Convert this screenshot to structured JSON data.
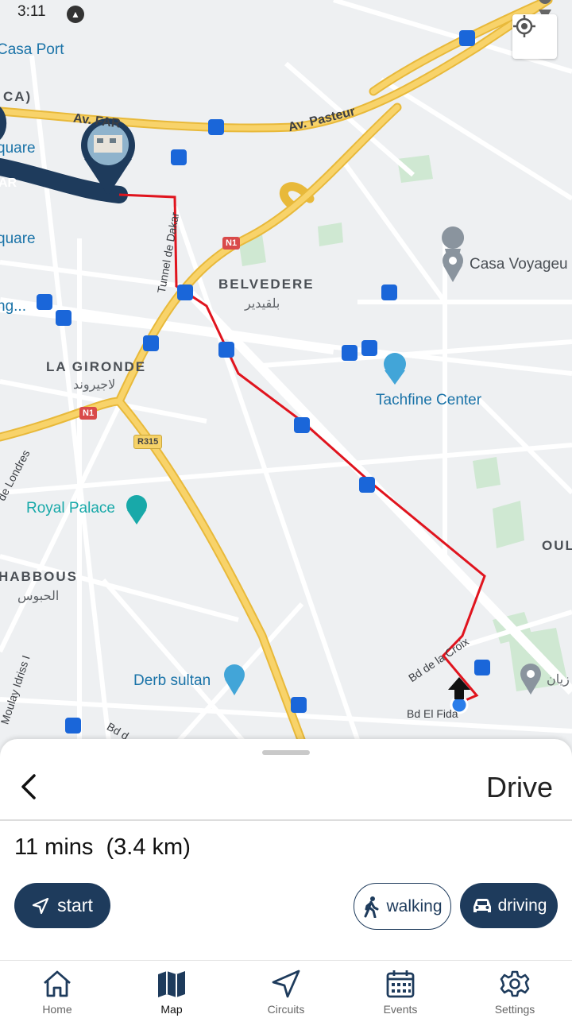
{
  "status_bar": {
    "time": "3:11"
  },
  "map": {
    "labels": {
      "casa_port": "Casa Port",
      "ca": "CA)",
      "av_pasteur": "Av. Pasteur",
      "av_far": "Av. FAR",
      "quare_1": "quare",
      "ar": "AR",
      "quare_2": "quare",
      "ng": "ng...",
      "belvedere": "BELVEDERE",
      "belvedere_ar": "بلقيدير",
      "casa_voyageurs": "Casa Voyageu",
      "tunnel_dakar": "Tunnel de Dakar",
      "la_gironde": "LA GIRONDE",
      "la_gironde_ar": "لاجيروند",
      "tachfine_center": "Tachfine Center",
      "n1_a": "N1",
      "n1_b": "N1",
      "r315": "R315",
      "de_londres": "de Londres",
      "royal_palace": "Royal Palace",
      "oul": "OUL",
      "habbous": "HABBOUS",
      "habbous_ar": "الحبوس",
      "bd_de_la_croix": "Bd de la Croix",
      "moulay_idriss": "Moulay Idriss I",
      "derb_sultan": "Derb sultan",
      "bd_el_fida": "Bd El Fida",
      "bd_d": "Bd d",
      "zayan_ar": "زيان"
    }
  },
  "sheet": {
    "mode_title": "Drive",
    "duration": "11 mins",
    "distance": "(3.4 km)",
    "start_label": "start",
    "walking_label": "walking",
    "driving_label": "driving"
  },
  "nav": {
    "home": "Home",
    "map": "Map",
    "circuits": "Circuits",
    "events": "Events",
    "settings": "Settings"
  },
  "colors": {
    "primary": "#1e3b5c",
    "route": "#e0141e",
    "major_road": "#f6c94a",
    "map_bg": "#eef0f2"
  }
}
